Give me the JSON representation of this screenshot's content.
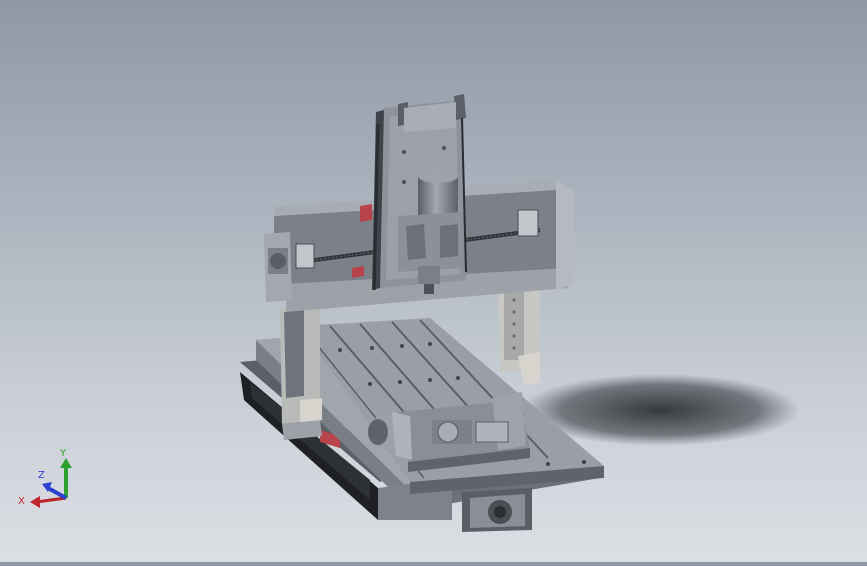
{
  "viewport": {
    "background_top": "#8e98a6",
    "background_bottom": "#dcdfe4"
  },
  "model": {
    "name": "cnc-gantry-router",
    "frame_color": "#8f949c",
    "dark_color": "#3f434a",
    "rail_accent_color": "#b8434a",
    "spindle_color": "#7d828b"
  },
  "triad": {
    "x_label": "X",
    "y_label": "Y",
    "z_label": "Z",
    "x_color": "#c0242c",
    "y_color": "#2ea02e",
    "z_color": "#2b3fd1"
  }
}
